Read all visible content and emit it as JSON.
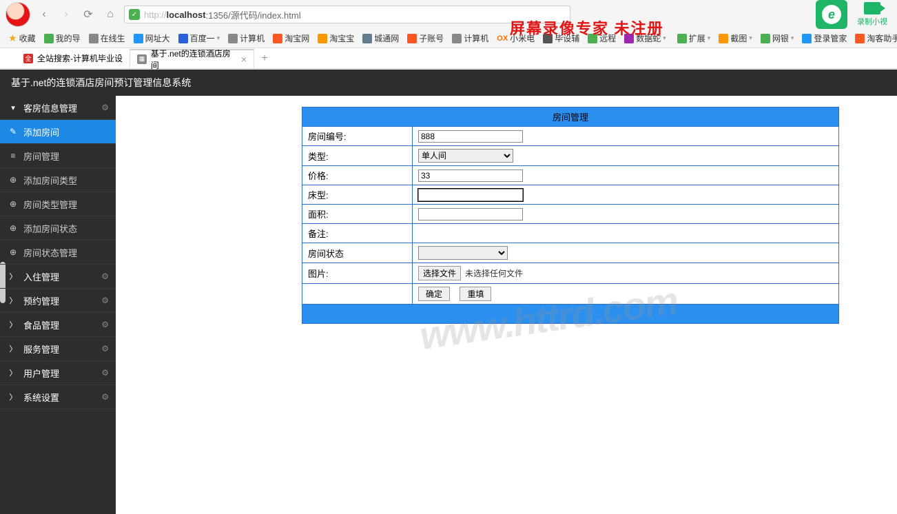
{
  "browser": {
    "url_prefix": "http://",
    "url_host": "localhost",
    "url_rest": ":1356/源代码/index.html",
    "watermark_top": "屏幕录像专家 未注册",
    "rec_label": "录制小视"
  },
  "bookmarks": [
    {
      "label": "收藏",
      "color": "#f5a623"
    },
    {
      "label": "我的导",
      "color": "#4caf50"
    },
    {
      "label": "在线生",
      "color": "#888"
    },
    {
      "label": "网址大",
      "color": "#2196f3"
    },
    {
      "label": "百度一",
      "color": "#2b5fd9"
    },
    {
      "label": "计算机",
      "color": "#888"
    },
    {
      "label": "淘宝网",
      "color": "#ff5722"
    },
    {
      "label": "淘宝宝",
      "color": "#ff9800"
    },
    {
      "label": "城通网",
      "color": "#607d8b"
    },
    {
      "label": "子账号",
      "color": "#ff5722"
    },
    {
      "label": "计算机",
      "color": "#888"
    },
    {
      "label": "小米电",
      "color": "#ff6f00"
    },
    {
      "label": "毕设辅",
      "color": "#555"
    },
    {
      "label": "远程",
      "color": "#4caf50"
    },
    {
      "label": "数据蛇",
      "color": "#9c27b0"
    },
    {
      "label": "扩展",
      "color": "#4caf50"
    },
    {
      "label": "截图",
      "color": "#ff9800"
    },
    {
      "label": "网银",
      "color": "#4caf50"
    },
    {
      "label": "登录管家",
      "color": "#2196f3"
    },
    {
      "label": "淘客助手",
      "color": "#ff5722"
    }
  ],
  "tabs": [
    {
      "label": "全站搜索-计算机毕业设",
      "active": false
    },
    {
      "label": "基于.net的连锁酒店房间",
      "active": true
    }
  ],
  "app_title": "基于.net的连锁酒店房间预订管理信息系统",
  "sidebar": [
    {
      "type": "section",
      "label": "客房信息管理",
      "icon": "▾",
      "gear": true
    },
    {
      "type": "item",
      "label": "添加房间",
      "icon": "✎",
      "active": true
    },
    {
      "type": "item",
      "label": "房间管理",
      "icon": "≡"
    },
    {
      "type": "item",
      "label": "添加房间类型",
      "icon": "⊕"
    },
    {
      "type": "item",
      "label": "房间类型管理",
      "icon": "⊕"
    },
    {
      "type": "item",
      "label": "添加房间状态",
      "icon": "⊕"
    },
    {
      "type": "item",
      "label": "房间状态管理",
      "icon": "⊕"
    },
    {
      "type": "section",
      "label": "入住管理",
      "icon": "〉",
      "gear": true
    },
    {
      "type": "section",
      "label": "预约管理",
      "icon": "〉",
      "gear": true
    },
    {
      "type": "section",
      "label": "食品管理",
      "icon": "〉",
      "gear": true
    },
    {
      "type": "section",
      "label": "服务管理",
      "icon": "〉",
      "gear": true
    },
    {
      "type": "section",
      "label": "用户管理",
      "icon": "〉",
      "gear": true
    },
    {
      "type": "section",
      "label": "系统设置",
      "icon": "〉",
      "gear": true
    }
  ],
  "form": {
    "title": "房间管理",
    "rows": {
      "room_no_label": "房间编号:",
      "room_no_value": "888",
      "type_label": "类型:",
      "type_value": "单人间",
      "price_label": "价格:",
      "price_value": "33",
      "bed_label": "床型:",
      "bed_value": "",
      "area_label": "面积:",
      "area_value": "",
      "remark_label": "备注:",
      "remark_value": "",
      "status_label": "房间状态",
      "status_value": "",
      "pic_label": "图片:",
      "pic_btn": "选择文件",
      "pic_text": "未选择任何文件",
      "ok_btn": "确定",
      "reset_btn": "重填"
    }
  },
  "watermark_mid": "www.httrd.com"
}
